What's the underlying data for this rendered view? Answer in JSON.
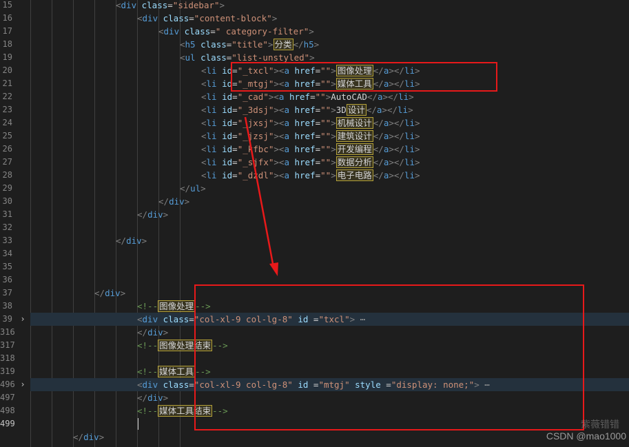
{
  "editor": {
    "line_numbers": [
      "15",
      "16",
      "17",
      "18",
      "19",
      "20",
      "21",
      "22",
      "23",
      "24",
      "25",
      "26",
      "27",
      "28",
      "29",
      "30",
      "31",
      "32",
      "33",
      "34",
      "35",
      "36",
      "37",
      "38",
      "39",
      "316",
      "317",
      "318",
      "319",
      "496",
      "497",
      "498",
      "499"
    ],
    "active_line": "499",
    "lines": [
      {
        "indent": 4,
        "tokens": [
          [
            "t",
            "<"
          ],
          [
            "tag",
            "div"
          ],
          [
            "attr",
            " class"
          ],
          [
            "eq",
            "="
          ],
          [
            "str",
            "\"sidebar\""
          ],
          [
            "t",
            ">"
          ]
        ]
      },
      {
        "indent": 5,
        "tokens": [
          [
            "t",
            "<"
          ],
          [
            "tag",
            "div"
          ],
          [
            "attr",
            " class"
          ],
          [
            "eq",
            "="
          ],
          [
            "str",
            "\"content-block\""
          ],
          [
            "t",
            ">"
          ]
        ]
      },
      {
        "indent": 6,
        "tokens": [
          [
            "t",
            "<"
          ],
          [
            "tag",
            "div"
          ],
          [
            "attr",
            " class"
          ],
          [
            "eq",
            "="
          ],
          [
            "str",
            "\" category-filter\""
          ],
          [
            "t",
            ">"
          ]
        ]
      },
      {
        "indent": 7,
        "tokens": [
          [
            "t",
            "<"
          ],
          [
            "tag",
            "h5"
          ],
          [
            "attr",
            " class"
          ],
          [
            "eq",
            "="
          ],
          [
            "str",
            "\"title\""
          ],
          [
            "t",
            ">"
          ],
          [
            "cjk",
            "分类"
          ],
          [
            "t",
            "</"
          ],
          [
            "tag",
            "h5"
          ],
          [
            "t",
            ">"
          ]
        ]
      },
      {
        "indent": 7,
        "tokens": [
          [
            "t",
            "<"
          ],
          [
            "tag",
            "ul"
          ],
          [
            "attr",
            " class"
          ],
          [
            "eq",
            "="
          ],
          [
            "str",
            "\"list-unstyled\""
          ],
          [
            "t",
            ">"
          ]
        ]
      },
      {
        "indent": 8,
        "tokens": [
          [
            "t",
            "<"
          ],
          [
            "tag",
            "li"
          ],
          [
            "attr",
            " id"
          ],
          [
            "eq",
            "="
          ],
          [
            "str",
            "\"_txcl\""
          ],
          [
            "t",
            "><"
          ],
          [
            "tag",
            "a"
          ],
          [
            "attr",
            " href"
          ],
          [
            "eq",
            "="
          ],
          [
            "str",
            "\"\""
          ],
          [
            "t",
            ">"
          ],
          [
            "cjk",
            "图像处理"
          ],
          [
            "t",
            "</"
          ],
          [
            "tag",
            "a"
          ],
          [
            "t",
            "></"
          ],
          [
            "tag",
            "li"
          ],
          [
            "t",
            ">"
          ]
        ]
      },
      {
        "indent": 8,
        "tokens": [
          [
            "t",
            "<"
          ],
          [
            "tag",
            "li"
          ],
          [
            "attr",
            " id"
          ],
          [
            "eq",
            "="
          ],
          [
            "str",
            "\"_mtgj\""
          ],
          [
            "t",
            "><"
          ],
          [
            "tag",
            "a"
          ],
          [
            "attr",
            " href"
          ],
          [
            "eq",
            "="
          ],
          [
            "str",
            "\"\""
          ],
          [
            "t",
            ">"
          ],
          [
            "cjk",
            "媒体工具"
          ],
          [
            "t",
            "</"
          ],
          [
            "tag",
            "a"
          ],
          [
            "t",
            "></"
          ],
          [
            "tag",
            "li"
          ],
          [
            "t",
            ">"
          ]
        ]
      },
      {
        "indent": 8,
        "tokens": [
          [
            "t",
            "<"
          ],
          [
            "tag",
            "li"
          ],
          [
            "attr",
            " id"
          ],
          [
            "eq",
            "="
          ],
          [
            "str",
            "\"_cad\""
          ],
          [
            "t",
            "><"
          ],
          [
            "tag",
            "a"
          ],
          [
            "attr",
            " href"
          ],
          [
            "eq",
            "="
          ],
          [
            "str",
            "\"\""
          ],
          [
            "t",
            ">"
          ],
          [
            "txt",
            "AutoCAD"
          ],
          [
            "t",
            "</"
          ],
          [
            "tag",
            "a"
          ],
          [
            "t",
            "></"
          ],
          [
            "tag",
            "li"
          ],
          [
            "t",
            ">"
          ]
        ]
      },
      {
        "indent": 8,
        "tokens": [
          [
            "t",
            "<"
          ],
          [
            "tag",
            "li"
          ],
          [
            "attr",
            " id"
          ],
          [
            "eq",
            "="
          ],
          [
            "str",
            "\"_3dsj\""
          ],
          [
            "t",
            "><"
          ],
          [
            "tag",
            "a"
          ],
          [
            "attr",
            " href"
          ],
          [
            "eq",
            "="
          ],
          [
            "str",
            "\"\""
          ],
          [
            "t",
            ">"
          ],
          [
            "txt",
            "3D"
          ],
          [
            "cjk",
            "设计"
          ],
          [
            "t",
            "</"
          ],
          [
            "tag",
            "a"
          ],
          [
            "t",
            "></"
          ],
          [
            "tag",
            "li"
          ],
          [
            "t",
            ">"
          ]
        ]
      },
      {
        "indent": 8,
        "tokens": [
          [
            "t",
            "<"
          ],
          [
            "tag",
            "li"
          ],
          [
            "attr",
            " id"
          ],
          [
            "eq",
            "="
          ],
          [
            "str",
            "\"_jxsj\""
          ],
          [
            "t",
            "><"
          ],
          [
            "tag",
            "a"
          ],
          [
            "attr",
            " href"
          ],
          [
            "eq",
            "="
          ],
          [
            "str",
            "\"\""
          ],
          [
            "t",
            ">"
          ],
          [
            "cjk",
            "机械设计"
          ],
          [
            "t",
            "</"
          ],
          [
            "tag",
            "a"
          ],
          [
            "t",
            "></"
          ],
          [
            "tag",
            "li"
          ],
          [
            "t",
            ">"
          ]
        ]
      },
      {
        "indent": 8,
        "tokens": [
          [
            "t",
            "<"
          ],
          [
            "tag",
            "li"
          ],
          [
            "attr",
            " id"
          ],
          [
            "eq",
            "="
          ],
          [
            "str",
            "\"_jzsj\""
          ],
          [
            "t",
            "><"
          ],
          [
            "tag",
            "a"
          ],
          [
            "attr",
            " href"
          ],
          [
            "eq",
            "="
          ],
          [
            "str",
            "\"\""
          ],
          [
            "t",
            ">"
          ],
          [
            "cjk",
            "建筑设计"
          ],
          [
            "t",
            "</"
          ],
          [
            "tag",
            "a"
          ],
          [
            "t",
            "></"
          ],
          [
            "tag",
            "li"
          ],
          [
            "t",
            ">"
          ]
        ]
      },
      {
        "indent": 8,
        "tokens": [
          [
            "t",
            "<"
          ],
          [
            "tag",
            "li"
          ],
          [
            "attr",
            " id"
          ],
          [
            "eq",
            "="
          ],
          [
            "str",
            "\"_kfbc\""
          ],
          [
            "t",
            "><"
          ],
          [
            "tag",
            "a"
          ],
          [
            "attr",
            " href"
          ],
          [
            "eq",
            "="
          ],
          [
            "str",
            "\"\""
          ],
          [
            "t",
            ">"
          ],
          [
            "cjk",
            "开发编程"
          ],
          [
            "t",
            "</"
          ],
          [
            "tag",
            "a"
          ],
          [
            "t",
            "></"
          ],
          [
            "tag",
            "li"
          ],
          [
            "t",
            ">"
          ]
        ]
      },
      {
        "indent": 8,
        "tokens": [
          [
            "t",
            "<"
          ],
          [
            "tag",
            "li"
          ],
          [
            "attr",
            " id"
          ],
          [
            "eq",
            "="
          ],
          [
            "str",
            "\"_sjfx\""
          ],
          [
            "t",
            "><"
          ],
          [
            "tag",
            "a"
          ],
          [
            "attr",
            " href"
          ],
          [
            "eq",
            "="
          ],
          [
            "str",
            "\"\""
          ],
          [
            "t",
            ">"
          ],
          [
            "cjk",
            "数据分析"
          ],
          [
            "t",
            "</"
          ],
          [
            "tag",
            "a"
          ],
          [
            "t",
            "></"
          ],
          [
            "tag",
            "li"
          ],
          [
            "t",
            ">"
          ]
        ]
      },
      {
        "indent": 8,
        "tokens": [
          [
            "t",
            "<"
          ],
          [
            "tag",
            "li"
          ],
          [
            "attr",
            " id"
          ],
          [
            "eq",
            "="
          ],
          [
            "str",
            "\"_dzdl\""
          ],
          [
            "t",
            "><"
          ],
          [
            "tag",
            "a"
          ],
          [
            "attr",
            " href"
          ],
          [
            "eq",
            "="
          ],
          [
            "str",
            "\"\""
          ],
          [
            "t",
            ">"
          ],
          [
            "cjk",
            "电子电路"
          ],
          [
            "t",
            "</"
          ],
          [
            "tag",
            "a"
          ],
          [
            "t",
            "></"
          ],
          [
            "tag",
            "li"
          ],
          [
            "t",
            ">"
          ]
        ]
      },
      {
        "indent": 7,
        "tokens": [
          [
            "t",
            "</"
          ],
          [
            "tag",
            "ul"
          ],
          [
            "t",
            ">"
          ]
        ]
      },
      {
        "indent": 6,
        "tokens": [
          [
            "t",
            "</"
          ],
          [
            "tag",
            "div"
          ],
          [
            "t",
            ">"
          ]
        ]
      },
      {
        "indent": 5,
        "tokens": [
          [
            "t",
            "</"
          ],
          [
            "tag",
            "div"
          ],
          [
            "t",
            ">"
          ]
        ]
      },
      {
        "indent": 4,
        "tokens": []
      },
      {
        "indent": 4,
        "tokens": [
          [
            "t",
            "</"
          ],
          [
            "tag",
            "div"
          ],
          [
            "t",
            ">"
          ]
        ]
      },
      {
        "indent": 4,
        "tokens": []
      },
      {
        "indent": 4,
        "tokens": []
      },
      {
        "indent": 4,
        "tokens": []
      },
      {
        "indent": 3,
        "tokens": [
          [
            "t",
            "</"
          ],
          [
            "tag",
            "div"
          ],
          [
            "t",
            ">"
          ]
        ]
      },
      {
        "indent": 5,
        "tokens": [
          [
            "cmt",
            "<!--"
          ],
          [
            "cjk",
            "图像处理"
          ],
          [
            "cmt",
            "-->"
          ]
        ]
      },
      {
        "indent": 5,
        "fold": true,
        "tokens": [
          [
            "t",
            "<"
          ],
          [
            "tag",
            "div"
          ],
          [
            "attr",
            " class"
          ],
          [
            "eq",
            "="
          ],
          [
            "str",
            "\"col-xl-9 col-lg-8\""
          ],
          [
            "attr",
            " id"
          ],
          [
            "eq",
            " ="
          ],
          [
            "str",
            "\"txcl\""
          ],
          [
            "t",
            ">"
          ],
          [
            "ell",
            " ⋯"
          ]
        ]
      },
      {
        "indent": 5,
        "tokens": [
          [
            "t",
            "</"
          ],
          [
            "tag",
            "div"
          ],
          [
            "t",
            ">"
          ]
        ]
      },
      {
        "indent": 5,
        "tokens": [
          [
            "cmt",
            "<!--"
          ],
          [
            "cjk",
            "图像处理结束"
          ],
          [
            "cmt",
            "-->"
          ]
        ]
      },
      {
        "indent": 5,
        "tokens": []
      },
      {
        "indent": 5,
        "tokens": [
          [
            "cmt",
            "<!--"
          ],
          [
            "cjk",
            "媒体工具"
          ],
          [
            "cmt",
            "-->"
          ]
        ]
      },
      {
        "indent": 5,
        "fold": true,
        "tokens": [
          [
            "t",
            "<"
          ],
          [
            "tag",
            "div"
          ],
          [
            "attr",
            " class"
          ],
          [
            "eq",
            "="
          ],
          [
            "str",
            "\"col-xl-9 col-lg-8\""
          ],
          [
            "attr",
            " id"
          ],
          [
            "eq",
            " ="
          ],
          [
            "str",
            "\"mtgj\""
          ],
          [
            "attr",
            " style"
          ],
          [
            "eq",
            " ="
          ],
          [
            "str",
            "\"display: none;\""
          ],
          [
            "t",
            ">"
          ],
          [
            "ell",
            " ⋯"
          ]
        ]
      },
      {
        "indent": 5,
        "tokens": [
          [
            "t",
            "</"
          ],
          [
            "tag",
            "div"
          ],
          [
            "t",
            ">"
          ]
        ]
      },
      {
        "indent": 5,
        "tokens": [
          [
            "cmt",
            "<!--"
          ],
          [
            "cjk",
            "媒体工具结束"
          ],
          [
            "cmt",
            "-->"
          ]
        ]
      },
      {
        "indent": 5,
        "tokens": []
      },
      {
        "indent": 2,
        "tokens": [
          [
            "t",
            "</"
          ],
          [
            "tag",
            "div"
          ],
          [
            "t",
            ">"
          ]
        ]
      }
    ]
  },
  "watermark": {
    "text": "CSDN @mao1000",
    "underlay": "紫薇错错"
  },
  "colors": {
    "background": "#1e1e1e",
    "annotation": "#e8191a"
  }
}
